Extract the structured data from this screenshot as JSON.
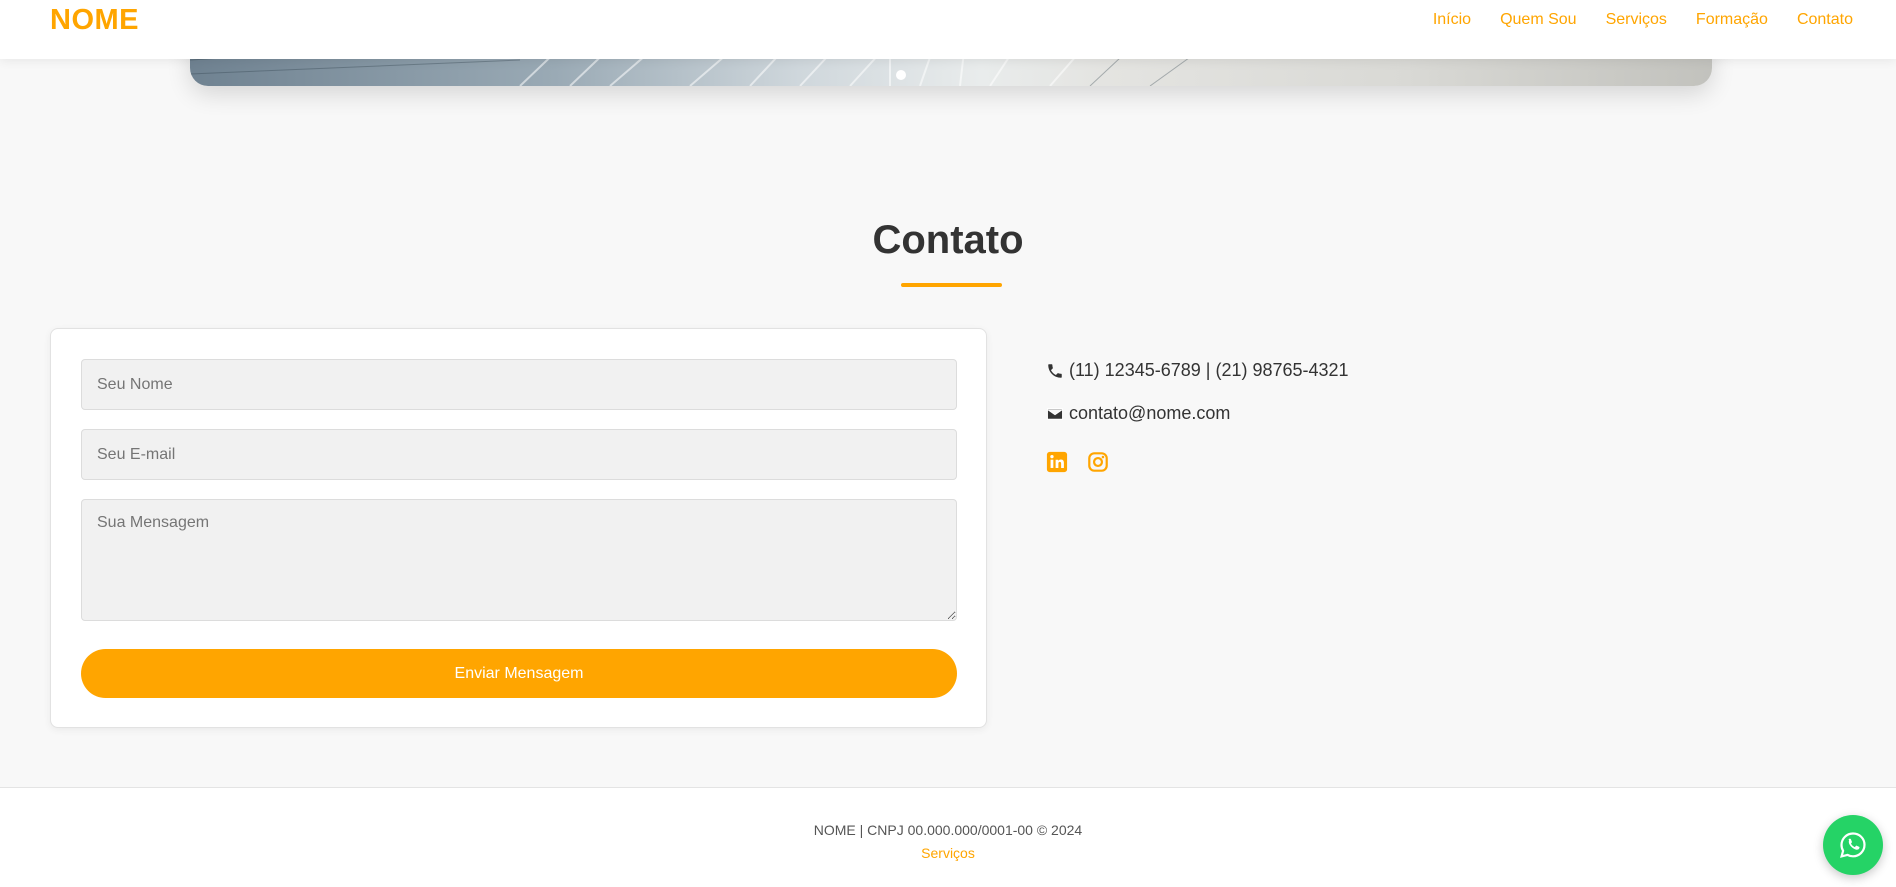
{
  "colors": {
    "accent": "#ffa500",
    "whatsapp": "#25d366"
  },
  "nav": {
    "logo": "NOME",
    "links": [
      "Início",
      "Quem Sou",
      "Serviços",
      "Formação",
      "Contato"
    ]
  },
  "contact": {
    "title": "Contato",
    "form": {
      "name_placeholder": "Seu Nome",
      "email_placeholder": "Seu E-mail",
      "message_placeholder": "Sua Mensagem",
      "submit_label": "Enviar Mensagem"
    },
    "phone": "(11) 12345-6789 | (21) 98765-4321",
    "email": "contato@nome.com",
    "social_icons": [
      "linkedin-icon",
      "instagram-icon"
    ]
  },
  "footer": {
    "text": "NOME | CNPJ 00.000.000/0001-00 © 2024",
    "link": "Serviços"
  },
  "floating": {
    "icon": "whatsapp-icon"
  }
}
